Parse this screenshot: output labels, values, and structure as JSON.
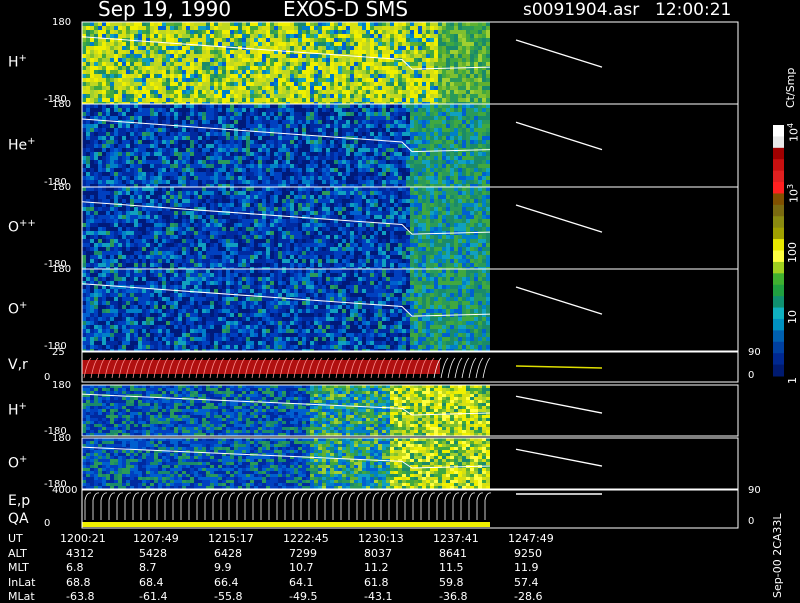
{
  "header": {
    "date": "Sep 19, 1990",
    "instrument": "EXOS-D SMS",
    "file": "s0091904.asr",
    "time": "12:00:21"
  },
  "colors": {
    "panel_border": "#ffffff",
    "background": "#000000"
  },
  "chart_data": {
    "type": "heatmap",
    "panels": [
      {
        "name": "H+",
        "label": "H",
        "sup": "+",
        "ymax": "180",
        "ymin": "-180"
      },
      {
        "name": "He+",
        "label": "He",
        "sup": "+",
        "ymax": "180",
        "ymin": "-180"
      },
      {
        "name": "O++",
        "label": "O",
        "sup": "++",
        "ymax": "180",
        "ymin": "-180"
      },
      {
        "name": "O+",
        "label": "O",
        "sup": "+",
        "ymax": "180",
        "ymin": "-180"
      },
      {
        "name": "V,r",
        "label": "V,r",
        "sup": "",
        "ymax": "25",
        "ymin": "0",
        "right_top": "90",
        "right_bottom": "0"
      },
      {
        "name": "H+ (2)",
        "label": "H",
        "sup": "+",
        "ymax": "180",
        "ymin": "-180"
      },
      {
        "name": "O+ (2)",
        "label": "O",
        "sup": "+",
        "ymax": "180",
        "ymin": "-180"
      },
      {
        "name": "E,p QA",
        "label": "E,p",
        "label2": "QA",
        "ymax": "4000",
        "ymin": "0",
        "right_top": "90",
        "right_bottom": "0"
      }
    ],
    "colorbar": {
      "unit": "Ct/Smp",
      "ticks": [
        {
          "label": "1",
          "value": 1
        },
        {
          "label": "10",
          "value": 10
        },
        {
          "label": "100",
          "value": 100
        },
        {
          "label": "10",
          "sup": "3",
          "value": 1000
        },
        {
          "label": "10",
          "sup": "4",
          "value": 10000
        }
      ]
    },
    "ephemeris": {
      "row_labels": [
        "UT",
        "ALT",
        "MLT",
        "InLat",
        "MLat"
      ],
      "columns": [
        {
          "UT": "1200:21",
          "ALT": "4312",
          "MLT": "6.8",
          "InLat": "68.8",
          "MLat": "-63.8"
        },
        {
          "UT": "1207:49",
          "ALT": "5428",
          "MLT": "8.7",
          "InLat": "68.4",
          "MLat": "-61.4"
        },
        {
          "UT": "1215:17",
          "ALT": "6428",
          "MLT": "9.9",
          "InLat": "66.4",
          "MLat": "-55.8"
        },
        {
          "UT": "1222:45",
          "ALT": "7299",
          "MLT": "10.7",
          "InLat": "64.1",
          "MLat": "-49.5"
        },
        {
          "UT": "1230:13",
          "ALT": "8037",
          "MLT": "11.2",
          "InLat": "61.8",
          "MLat": "-43.1"
        },
        {
          "UT": "1237:41",
          "ALT": "8641",
          "MLT": "11.5",
          "InLat": "59.8",
          "MLat": "-36.8"
        },
        {
          "UT": "1247:49",
          "ALT": "9250",
          "MLT": "11.9",
          "InLat": "57.4",
          "MLat": "-28.6"
        }
      ]
    },
    "footer_rotated": "Sep-00 2CA33L"
  }
}
